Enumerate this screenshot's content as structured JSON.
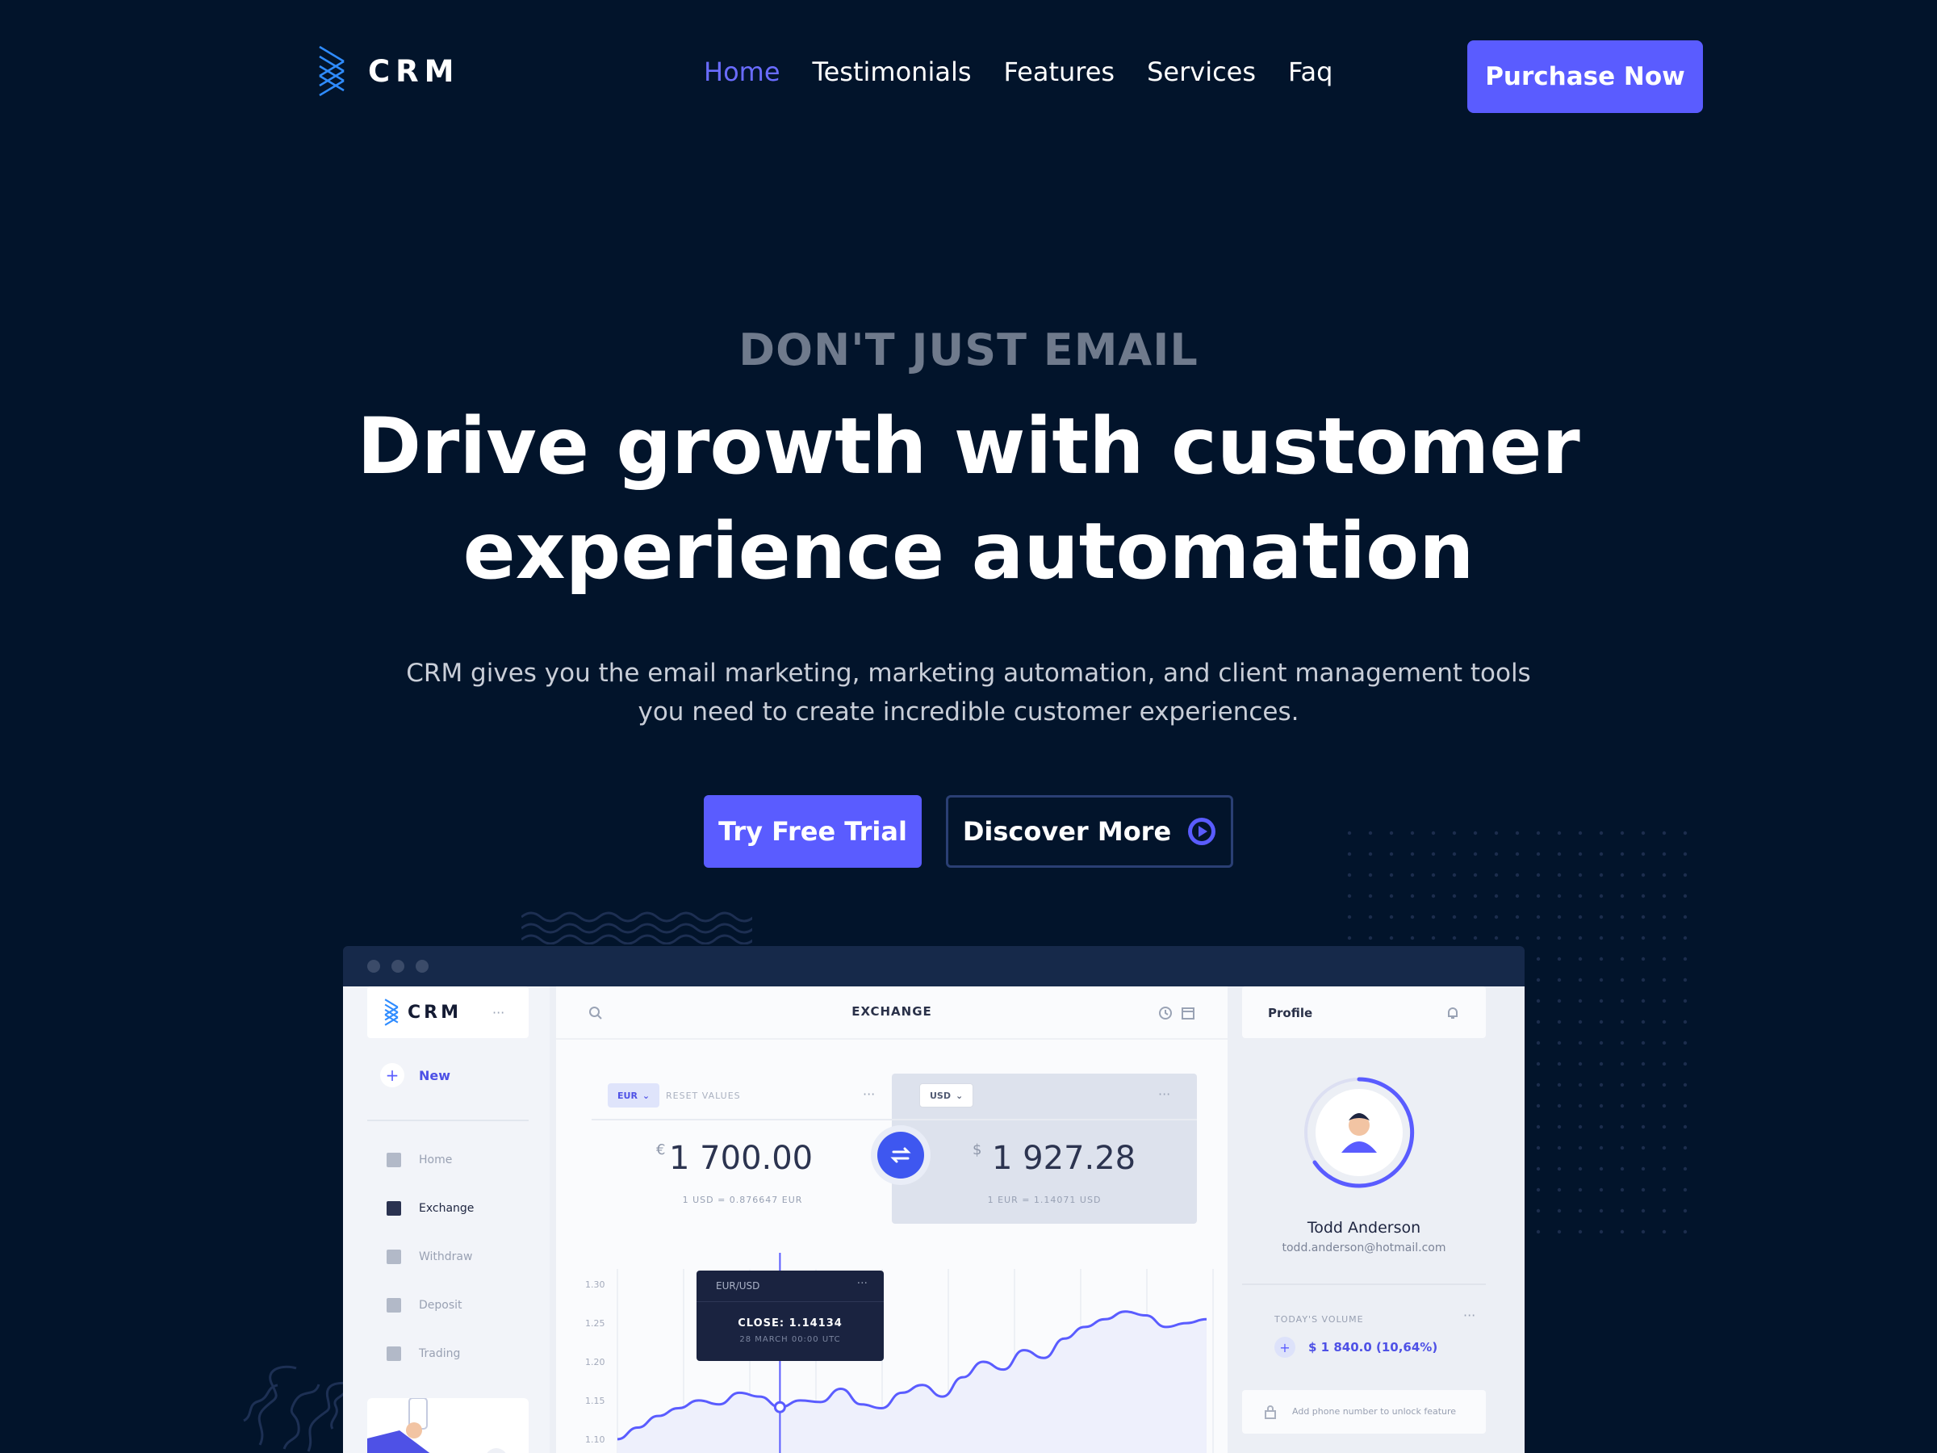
{
  "brand": {
    "name": "CRM",
    "accent": "#5a5cff",
    "background": "#02142b"
  },
  "nav": {
    "links": [
      {
        "label": "Home",
        "active": true
      },
      {
        "label": "Testimonials",
        "active": false
      },
      {
        "label": "Features",
        "active": false
      },
      {
        "label": "Services",
        "active": false
      },
      {
        "label": "Faq",
        "active": false
      }
    ],
    "cta": "Purchase Now"
  },
  "hero": {
    "eyebrow": "DON'T JUST EMAIL",
    "headline": "Drive growth with customer experience automation",
    "subtext": "CRM gives you the email marketing, marketing automation, and client management tools you need to create incredible customer experiences.",
    "primary_button": "Try Free Trial",
    "secondary_button": "Discover More",
    "secondary_icon": "play-circle-icon"
  },
  "dashboard": {
    "logo": "CRM",
    "logo_more": "···",
    "new_label": "New",
    "sidebar": [
      {
        "label": "Home",
        "icon": "home-icon",
        "active": false
      },
      {
        "label": "Exchange",
        "icon": "exchange-icon",
        "active": true
      },
      {
        "label": "Withdraw",
        "icon": "withdraw-icon",
        "active": false
      },
      {
        "label": "Deposit",
        "icon": "deposit-icon",
        "active": false
      },
      {
        "label": "Trading",
        "icon": "trading-icon",
        "active": false
      }
    ],
    "title": "EXCHANGE",
    "from": {
      "currency": "EUR",
      "reset": "RESET VALUES",
      "symbol": "€",
      "amount": "1 700.00",
      "rate": "1 USD = 0.876647 EUR"
    },
    "to": {
      "currency": "USD",
      "symbol": "$",
      "amount": "1 927.28",
      "rate": "1 EUR = 1.14071 USD"
    },
    "more": "···",
    "tooltip": {
      "pair": "EUR/USD",
      "close": "CLOSE: 1.14134",
      "date": "28 MARCH 00:00 UTC"
    },
    "chart_data": {
      "type": "line",
      "y_ticks": [
        "1.30",
        "1.25",
        "1.20",
        "1.15",
        "1.10"
      ],
      "ylim": [
        1.08,
        1.32
      ],
      "values": [
        1.1,
        1.115,
        1.13,
        1.14,
        1.15,
        1.145,
        1.16,
        1.155,
        1.14134,
        1.15,
        1.148,
        1.165,
        1.145,
        1.14,
        1.16,
        1.17,
        1.155,
        1.18,
        1.2,
        1.19,
        1.215,
        1.205,
        1.23,
        1.245,
        1.255,
        1.265,
        1.26,
        1.245,
        1.25,
        1.255
      ]
    },
    "profile": {
      "title": "Profile",
      "name": "Todd Anderson",
      "email": "todd.anderson@hotmail.com",
      "volume_label": "TODAY'S VOLUME",
      "volume_more": "···",
      "volume_value": "$ 1 840.0 (10,64%)",
      "unlock_text": "Add phone number to unlock feature"
    }
  }
}
